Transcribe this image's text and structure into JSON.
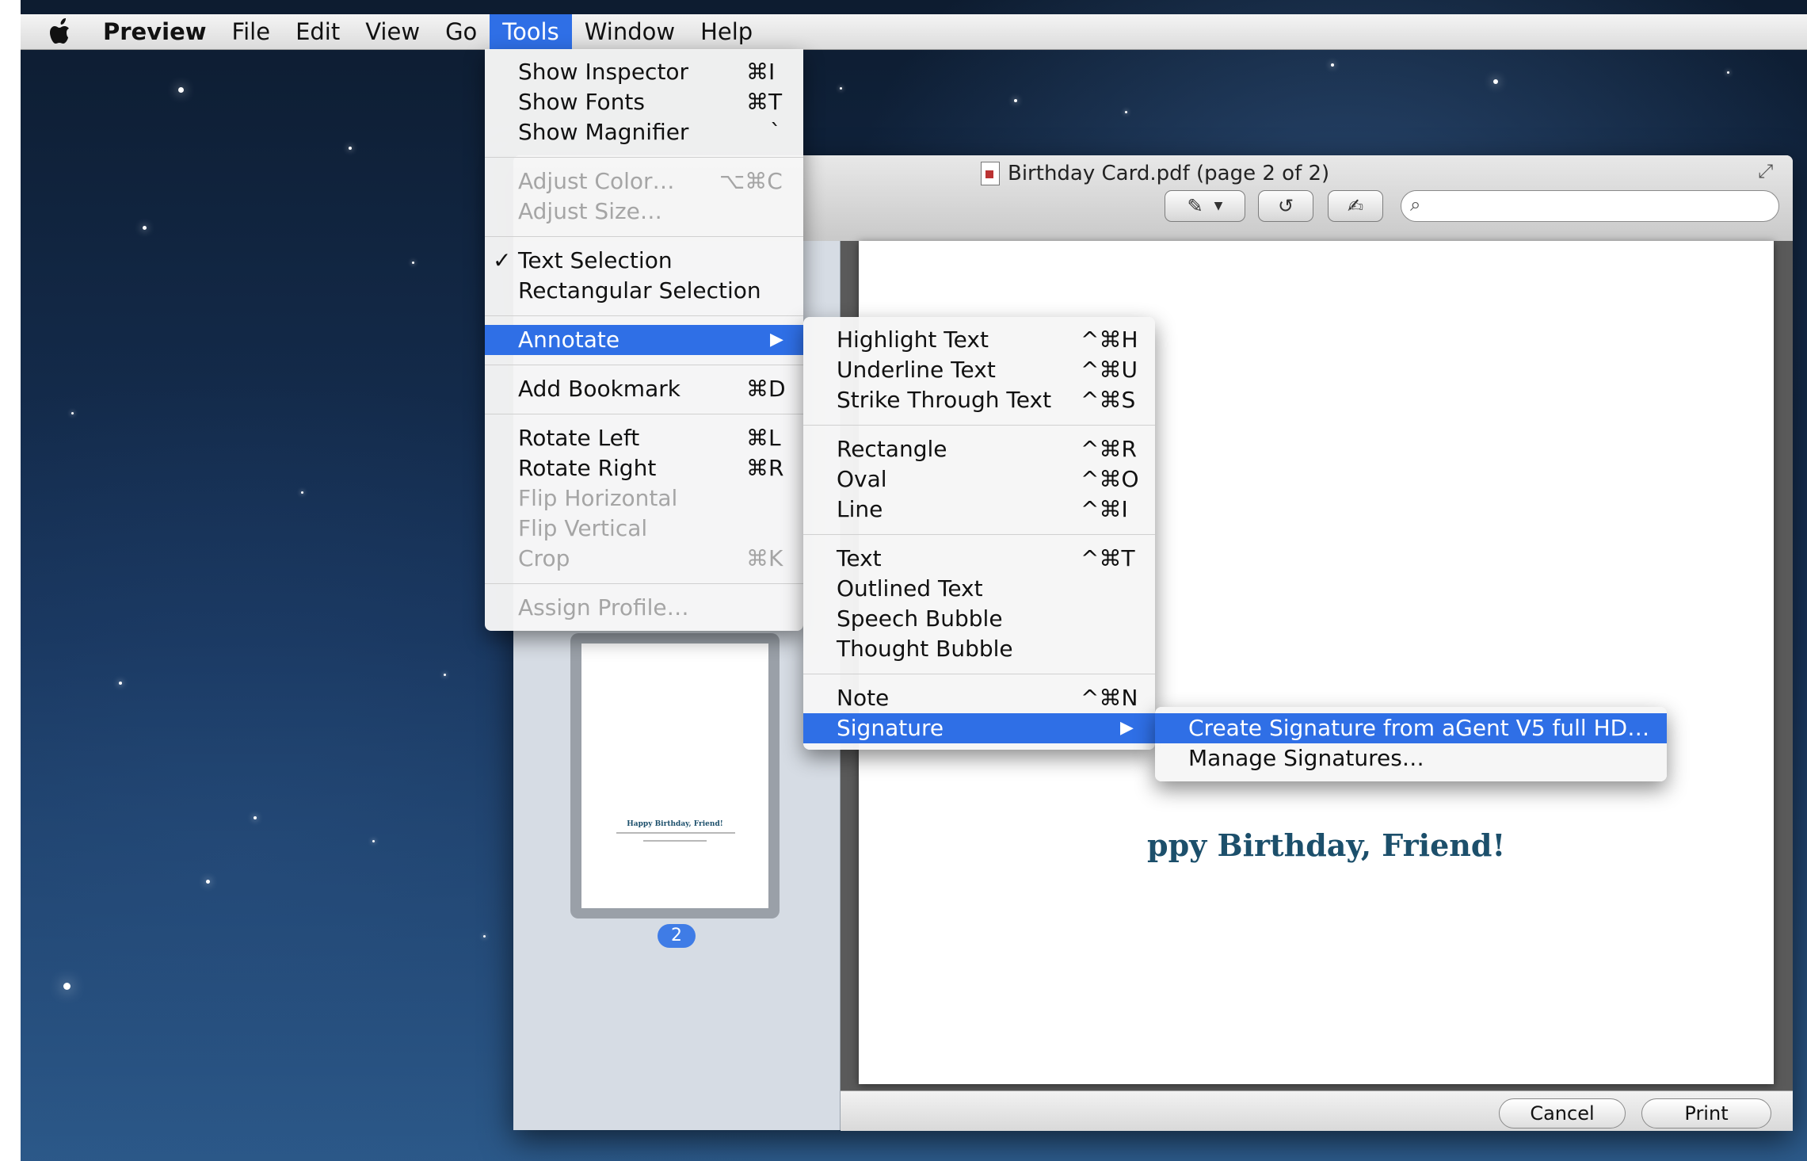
{
  "menubar": {
    "app": "Preview",
    "items": [
      "File",
      "Edit",
      "View",
      "Go",
      "Tools",
      "Window",
      "Help"
    ]
  },
  "window": {
    "title": "Birthday Card.pdf (page 2 of 2)",
    "search_placeholder": "",
    "page_heading": "ppy Birthday, Friend!",
    "thumb_heading": "Happy Birthday, Friend!",
    "page_badge": "2",
    "cancel_label": "Cancel",
    "print_label": "Print"
  },
  "tools_menu": {
    "show_inspector": {
      "label": "Show Inspector",
      "shortcut": "⌘I"
    },
    "show_fonts": {
      "label": "Show Fonts",
      "shortcut": "⌘T"
    },
    "show_magnifier": {
      "label": "Show Magnifier",
      "shortcut": "`"
    },
    "adjust_color": {
      "label": "Adjust Color…",
      "shortcut": "⌥⌘C"
    },
    "adjust_size": {
      "label": "Adjust Size…",
      "shortcut": ""
    },
    "text_selection": {
      "label": "Text Selection",
      "check": "✓"
    },
    "rectangular_selection": {
      "label": "Rectangular Selection"
    },
    "annotate": {
      "label": "Annotate",
      "arrow": "▶"
    },
    "add_bookmark": {
      "label": "Add Bookmark",
      "shortcut": "⌘D"
    },
    "rotate_left": {
      "label": "Rotate Left",
      "shortcut": "⌘L"
    },
    "rotate_right": {
      "label": "Rotate Right",
      "shortcut": "⌘R"
    },
    "flip_horizontal": {
      "label": "Flip Horizontal"
    },
    "flip_vertical": {
      "label": "Flip Vertical"
    },
    "crop": {
      "label": "Crop",
      "shortcut": "⌘K"
    },
    "assign_profile": {
      "label": "Assign Profile…"
    }
  },
  "annotate_menu": {
    "highlight": {
      "label": "Highlight Text",
      "shortcut": "^⌘H"
    },
    "underline": {
      "label": "Underline Text",
      "shortcut": "^⌘U"
    },
    "strike": {
      "label": "Strike Through Text",
      "shortcut": "^⌘S"
    },
    "rectangle": {
      "label": "Rectangle",
      "shortcut": "^⌘R"
    },
    "oval": {
      "label": "Oval",
      "shortcut": "^⌘O"
    },
    "line": {
      "label": "Line",
      "shortcut": "^⌘I"
    },
    "text": {
      "label": "Text",
      "shortcut": "^⌘T"
    },
    "outlined_text": {
      "label": "Outlined Text"
    },
    "speech_bubble": {
      "label": "Speech Bubble"
    },
    "thought_bubble": {
      "label": "Thought Bubble"
    },
    "note": {
      "label": "Note",
      "shortcut": "^⌘N"
    },
    "signature": {
      "label": "Signature",
      "arrow": "▶"
    }
  },
  "signature_menu": {
    "create": "Create Signature from aGent V5 full HD…",
    "manage": "Manage Signatures…"
  },
  "colors": {
    "highlight": "#2f6fe6",
    "heading": "#1c4f6b"
  }
}
